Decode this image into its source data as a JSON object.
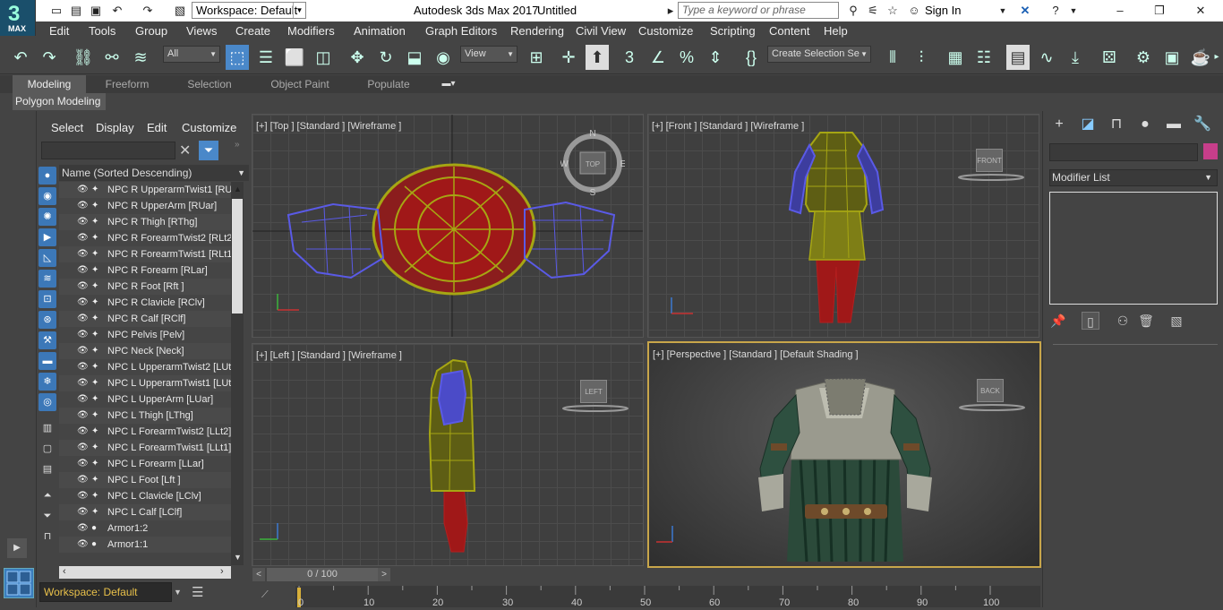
{
  "app": {
    "logo_number": "3",
    "logo_text": "MAX",
    "title": "Autodesk 3ds Max 2017",
    "document": "Untitled",
    "workspace": "Workspace: Default",
    "search_placeholder": "Type a keyword or phrase",
    "sign_in": "Sign In"
  },
  "menu": [
    "Edit",
    "Tools",
    "Group",
    "Views",
    "Create",
    "Modifiers",
    "Animation",
    "Graph Editors",
    "Rendering",
    "Civil View",
    "Customize",
    "Scripting",
    "Content",
    "Help"
  ],
  "toolbar": {
    "selection_filter": "All",
    "ref_coord": "View",
    "selection_set": "Create Selection Se"
  },
  "ribbon": {
    "tabs": [
      "Modeling",
      "Freeform",
      "Selection",
      "Object Paint",
      "Populate"
    ],
    "panel": "Polygon Modeling"
  },
  "scene_explorer": {
    "menus": [
      "Select",
      "Display",
      "Edit",
      "Customize"
    ],
    "column": "Name (Sorted Descending)",
    "rows": [
      "NPC R UpperarmTwist1 [RUt",
      "NPC R UpperArm [RUar]",
      "NPC R Thigh [RThg]",
      "NPC R ForearmTwist2 [RLt2]",
      "NPC R ForearmTwist1 [RLt1]",
      "NPC R Forearm [RLar]",
      "NPC R Foot [Rft ]",
      "NPC R Clavicle [RClv]",
      "NPC R Calf [RClf]",
      "NPC Pelvis [Pelv]",
      "NPC Neck [Neck]",
      "NPC L UpperarmTwist2 [LUt2",
      "NPC L UpperarmTwist1 [LUt1",
      "NPC L UpperArm [LUar]",
      "NPC L Thigh [LThg]",
      "NPC L ForearmTwist2 [LLt2]",
      "NPC L ForearmTwist1 [LLt1]",
      "NPC L Forearm [LLar]",
      "NPC L Foot [Lft ]",
      "NPC L Clavicle [LClv]",
      "NPC L Calf [LClf]",
      "Armor1:2",
      "Armor1:1"
    ],
    "workspace": "Workspace: Default"
  },
  "viewports": {
    "top": "[+] [Top ] [Standard ] [Wireframe ]",
    "front": "[+] [Front ] [Standard ] [Wireframe ]",
    "left": "[+] [Left ] [Standard ] [Wireframe ]",
    "perspective": "[+] [Perspective ] [Standard ] [Default Shading ]",
    "cube_top": "TOP",
    "cube_front": "FRONT",
    "cube_left": "LEFT",
    "cube_back": "BACK",
    "compass": {
      "n": "N",
      "s": "S",
      "e": "E",
      "w": "W"
    }
  },
  "timeline": {
    "frame": "0 / 100",
    "ticks": [
      "0",
      "10",
      "20",
      "30",
      "40",
      "50",
      "60",
      "70",
      "80",
      "90",
      "100"
    ]
  },
  "command_panel": {
    "modifier_list": "Modifier List",
    "swatch_color": "#c73e8a"
  },
  "colors": {
    "accent": "#3c78b8",
    "wire_yellow": "#a6a613",
    "wire_blue": "#5a5ae6",
    "wire_red": "#b4141e",
    "active_border": "#c8a64a"
  }
}
